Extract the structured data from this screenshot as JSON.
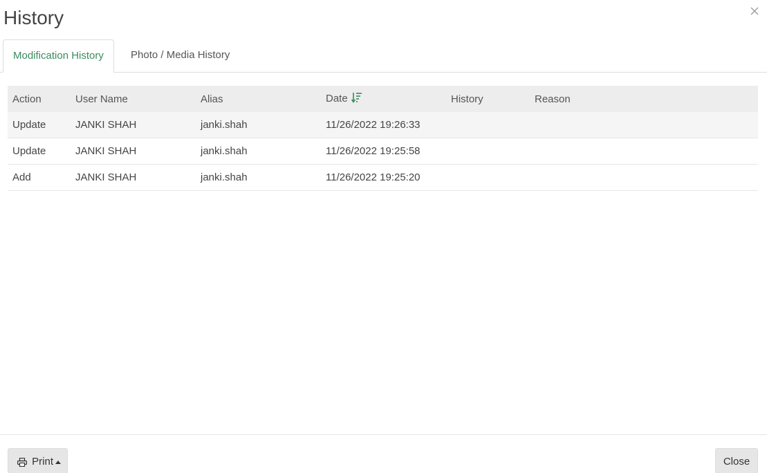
{
  "dialog": {
    "title": "History"
  },
  "tabs": [
    {
      "label": "Modification History",
      "active": true
    },
    {
      "label": "Photo / Media History",
      "active": false
    }
  ],
  "table": {
    "columns": [
      "Action",
      "User Name",
      "Alias",
      "Date",
      "History",
      "Reason"
    ],
    "sort_column": "Date",
    "rows": [
      {
        "action": "Update",
        "user_name": "JANKI SHAH",
        "alias": "janki.shah",
        "date": "11/26/2022 19:26:33",
        "history": "",
        "reason": ""
      },
      {
        "action": "Update",
        "user_name": "JANKI SHAH",
        "alias": "janki.shah",
        "date": "11/26/2022 19:25:58",
        "history": "",
        "reason": ""
      },
      {
        "action": "Add",
        "user_name": "JANKI SHAH",
        "alias": "janki.shah",
        "date": "11/26/2022 19:25:20",
        "history": "",
        "reason": ""
      }
    ]
  },
  "footer": {
    "print_label": "Print",
    "close_label": "Close"
  },
  "colors": {
    "accent": "#3a8a5e",
    "header_bg": "#ededed"
  },
  "icons": {
    "close": "close-icon",
    "sort": "sort-descending-icon",
    "print": "printer-icon",
    "caret": "caret-up-icon"
  }
}
